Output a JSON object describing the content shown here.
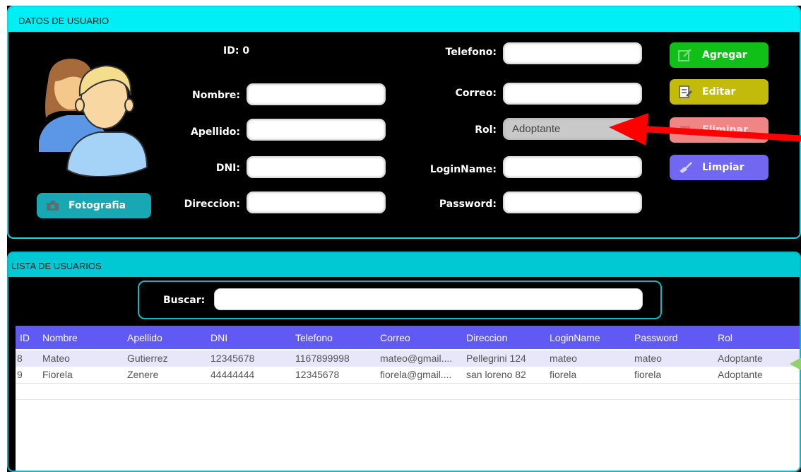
{
  "datos": {
    "header": "DATOS DE USUARIO",
    "id_label": "ID:",
    "id_value": "0",
    "nombre_label": "Nombre:",
    "apellido_label": "Apellido:",
    "dni_label": "DNI:",
    "direccion_label": "Direccion:",
    "telefono_label": "Telefono:",
    "correo_label": "Correo:",
    "rol_label": "Rol:",
    "rol_value": "Adoptante",
    "loginname_label": "LoginName:",
    "password_label": "Password:",
    "foto_button": "Fotografia",
    "agregar": "Agregar",
    "editar": "Editar",
    "eliminar": "Eliminar",
    "limpiar": "Limpiar"
  },
  "lista": {
    "header": "LISTA DE USUARIOS",
    "buscar_label": "Buscar:",
    "columns": [
      "ID",
      "Nombre",
      "Apellido",
      "DNI",
      "Telefono",
      "Correo",
      "Direccion",
      "LoginName",
      "Password",
      "Rol"
    ],
    "rows": [
      [
        "8",
        "Mateo",
        "Gutierrez",
        "12345678",
        "1167899998",
        "mateo@gmail....",
        "Pellegrini 124",
        "mateo",
        "mateo",
        "Adoptante"
      ],
      [
        "9",
        "Fiorela",
        "Zenere",
        "44444444",
        "12345678",
        "fiorela@gmail....",
        "san loreno 82",
        "fiorela",
        "fiorela",
        "Adoptante"
      ]
    ]
  },
  "colors": {
    "cyan": "#00eef6",
    "agregar": "#11c016",
    "editar": "#c2bb0b",
    "eliminar": "#f08585",
    "limpiar": "#7267f0",
    "table_header": "#6159f3"
  },
  "icons": [
    "user-group-icon",
    "camera-icon",
    "edit-icon",
    "document-edit-icon",
    "broom-icon",
    "red-arrow"
  ]
}
